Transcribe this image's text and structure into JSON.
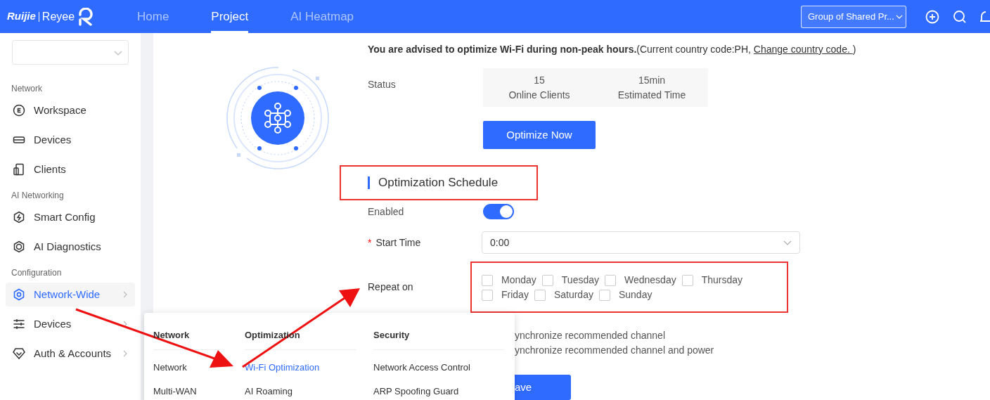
{
  "header": {
    "logo": {
      "brand": "Ruijie",
      "product": "Reyee"
    },
    "nav": [
      {
        "label": "Home",
        "selected": false
      },
      {
        "label": "Project",
        "selected": true
      },
      {
        "label": "AI Heatmap",
        "selected": false
      }
    ],
    "group_select": "Group of Shared Pr..."
  },
  "sidebar": {
    "sections": [
      {
        "title": "Network",
        "items": [
          {
            "label": "Workspace",
            "selected": false,
            "expandable": false
          },
          {
            "label": "Devices",
            "selected": false,
            "expandable": false
          },
          {
            "label": "Clients",
            "selected": false,
            "expandable": false
          }
        ]
      },
      {
        "title": "AI Networking",
        "items": [
          {
            "label": "Smart Config",
            "selected": false,
            "expandable": false
          },
          {
            "label": "AI Diagnostics",
            "selected": false,
            "expandable": false
          }
        ]
      },
      {
        "title": "Configuration",
        "items": [
          {
            "label": "Network-Wide",
            "selected": true,
            "expandable": true
          },
          {
            "label": "Devices",
            "selected": false,
            "expandable": true
          },
          {
            "label": "Auth & Accounts",
            "selected": false,
            "expandable": true
          }
        ]
      }
    ]
  },
  "content": {
    "advice": "**You are advised to optimize Wi-Fi during non-peak hours.**(Current country code:PH, ",
    "advice_link": "Change country code. ",
    "advice_end": ")",
    "status": {
      "label": "Status",
      "stats": [
        {
          "value": "15",
          "label": "Online Clients"
        },
        {
          "value": "15min",
          "label": "Estimated Time"
        }
      ]
    },
    "optimize_button": "Optimize Now",
    "schedule": {
      "title": "Optimization Schedule",
      "enabled": {
        "label": "Enabled",
        "on": true
      },
      "start_time": {
        "required_mark": "*",
        "label": "Start Time",
        "value": "0:00"
      },
      "repeat": {
        "label": "Repeat on",
        "days": [
          {
            "label": "Monday",
            "checked": false
          },
          {
            "label": "Tuesday",
            "checked": false
          },
          {
            "label": "Wednesday",
            "checked": false
          },
          {
            "label": "Thursday",
            "checked": false
          },
          {
            "label": "Friday",
            "checked": false
          },
          {
            "label": "Saturday",
            "checked": false
          },
          {
            "label": "Sunday",
            "checked": false
          }
        ]
      },
      "sync_options": [
        "ynchronize recommended channel",
        "ynchronize recommended channel and power"
      ],
      "save_button": "ave"
    }
  },
  "menu": {
    "columns": [
      {
        "title": "Network",
        "items": [
          {
            "label": "Network",
            "selected": false
          },
          {
            "label": "Multi-WAN",
            "selected": false
          }
        ]
      },
      {
        "title": "Optimization",
        "items": [
          {
            "label": "Wi-Fi Optimization",
            "selected": true
          },
          {
            "label": "AI Roaming",
            "selected": false
          }
        ]
      },
      {
        "title": "Security",
        "items": [
          {
            "label": "Network Access Control",
            "selected": false
          },
          {
            "label": "ARP Spoofing Guard",
            "selected": false
          }
        ]
      }
    ]
  }
}
